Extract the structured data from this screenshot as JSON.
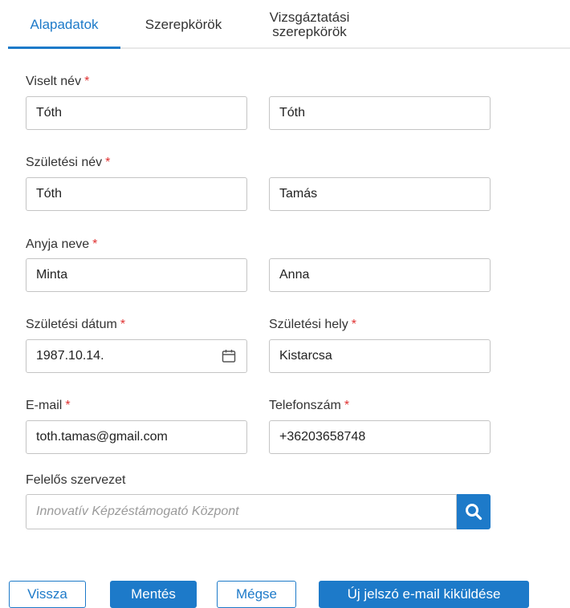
{
  "tabs": [
    {
      "label": "Alapadatok",
      "active": true
    },
    {
      "label": "Szerepkörök",
      "active": false
    },
    {
      "label_line1": "Vizsgáztatási",
      "label_line2": "szerepkörök",
      "active": false
    }
  ],
  "required_mark": "*",
  "fields": {
    "viselt_nev": {
      "label": "Viselt név",
      "value1": "Tóth",
      "value2": "Tóth"
    },
    "szuletesi_nev": {
      "label": "Születési név",
      "value1": "Tóth",
      "value2": "Tamás"
    },
    "anyja_neve": {
      "label": "Anyja neve",
      "value1": "Minta",
      "value2": "Anna"
    },
    "szuletesi_datum": {
      "label": "Születési dátum",
      "value": "1987.10.14."
    },
    "szuletesi_hely": {
      "label": "Születési hely",
      "value": "Kistarcsa"
    },
    "email": {
      "label": "E-mail",
      "value": "toth.tamas@gmail.com"
    },
    "telefonszam": {
      "label": "Telefonszám",
      "value": "+36203658748"
    },
    "felelos_szervezet": {
      "label": "Felelős szervezet",
      "placeholder": "Innovatív Képzéstámogató Központ"
    }
  },
  "buttons": {
    "back": "Vissza",
    "save": "Mentés",
    "cancel": "Mégse",
    "send_password": "Új jelszó e-mail kiküldése"
  },
  "icons": {
    "calendar": "calendar-icon",
    "search": "search-icon"
  },
  "colors": {
    "accent": "#1d7ac9",
    "required": "#e03131",
    "border": "#c4c4c4"
  }
}
